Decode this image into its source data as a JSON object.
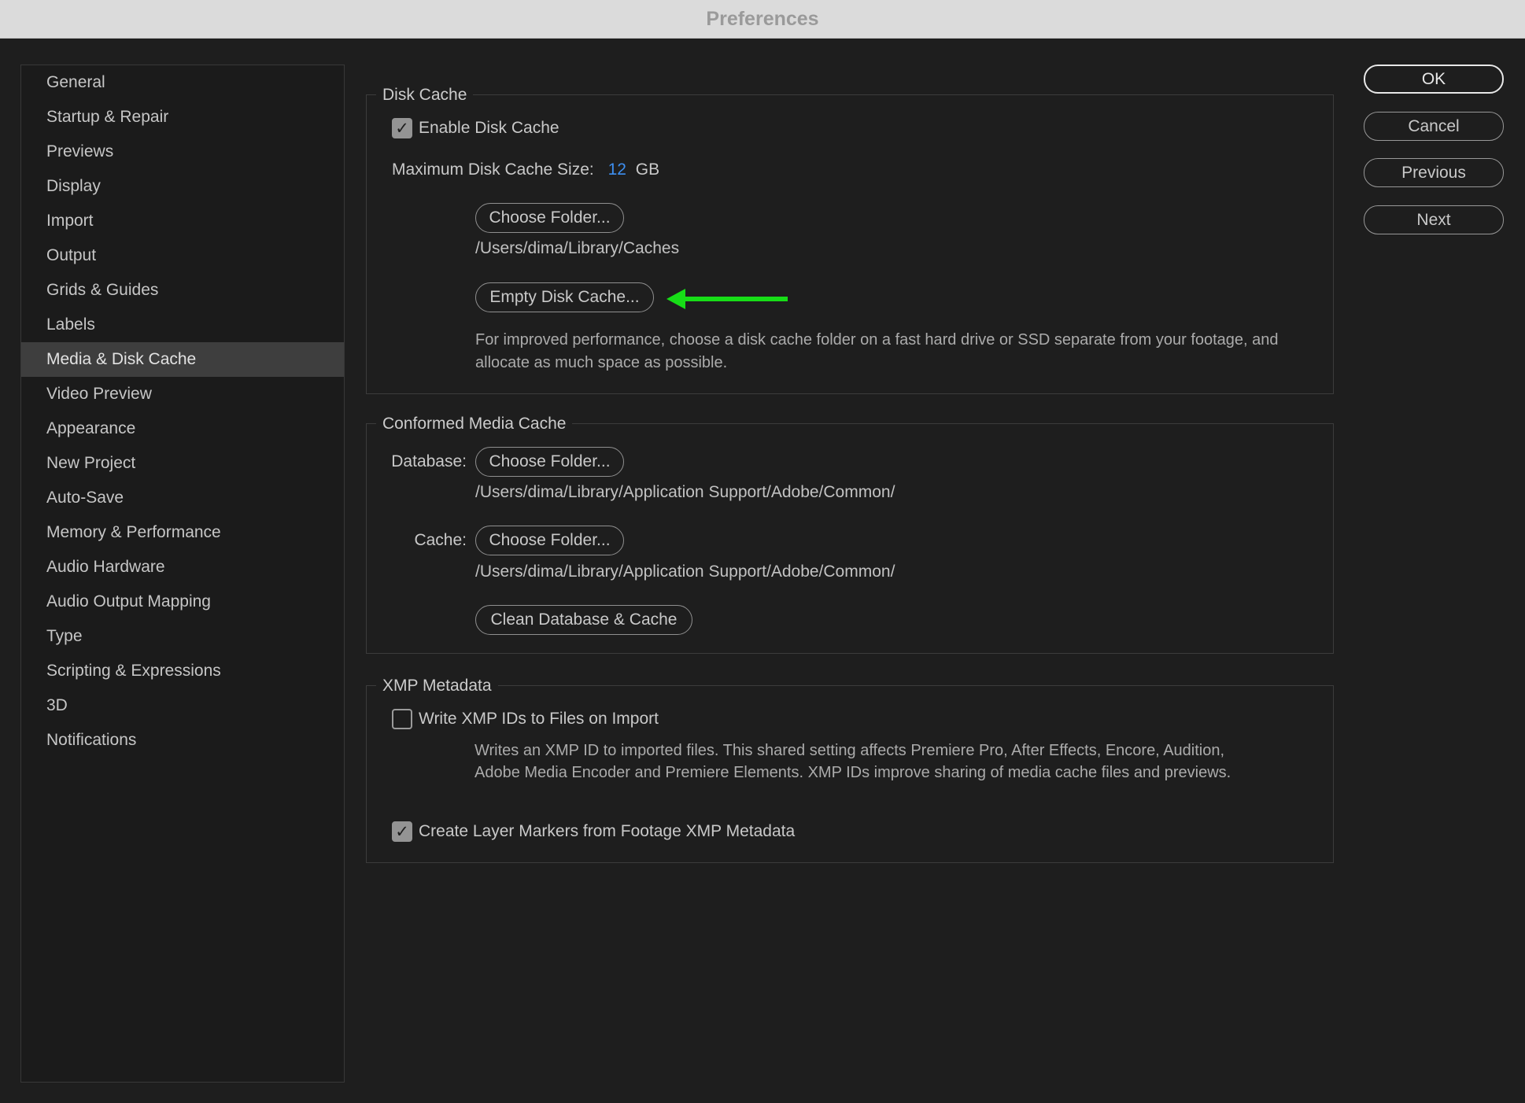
{
  "titlebar": {
    "title": "Preferences"
  },
  "sidebar": {
    "items": [
      {
        "label": "General",
        "selected": false
      },
      {
        "label": "Startup & Repair",
        "selected": false
      },
      {
        "label": "Previews",
        "selected": false
      },
      {
        "label": "Display",
        "selected": false
      },
      {
        "label": "Import",
        "selected": false
      },
      {
        "label": "Output",
        "selected": false
      },
      {
        "label": "Grids & Guides",
        "selected": false
      },
      {
        "label": "Labels",
        "selected": false
      },
      {
        "label": "Media & Disk Cache",
        "selected": true
      },
      {
        "label": "Video Preview",
        "selected": false
      },
      {
        "label": "Appearance",
        "selected": false
      },
      {
        "label": "New Project",
        "selected": false
      },
      {
        "label": "Auto-Save",
        "selected": false
      },
      {
        "label": "Memory & Performance",
        "selected": false
      },
      {
        "label": "Audio Hardware",
        "selected": false
      },
      {
        "label": "Audio Output Mapping",
        "selected": false
      },
      {
        "label": "Type",
        "selected": false
      },
      {
        "label": "Scripting & Expressions",
        "selected": false
      },
      {
        "label": "3D",
        "selected": false
      },
      {
        "label": "Notifications",
        "selected": false
      }
    ]
  },
  "groups": {
    "disk_cache": {
      "legend": "Disk Cache",
      "enable_label": "Enable Disk Cache",
      "enable_checked": true,
      "max_size_label": "Maximum Disk Cache Size:",
      "max_size_value": "12",
      "max_size_unit": "GB",
      "choose_folder_button": "Choose Folder...",
      "folder_path": "/Users/dima/Library/Caches",
      "empty_button": "Empty Disk Cache...",
      "help_text": "For improved performance, choose a disk cache folder on a fast hard drive or SSD separate from your footage, and allocate as much space as possible."
    },
    "conformed": {
      "legend": "Conformed Media Cache",
      "database_label": "Database:",
      "database_button": "Choose Folder...",
      "database_path": "/Users/dima/Library/Application Support/Adobe/Common/",
      "cache_label": "Cache:",
      "cache_button": "Choose Folder...",
      "cache_path": "/Users/dima/Library/Application Support/Adobe/Common/",
      "clean_button": "Clean Database & Cache"
    },
    "xmp": {
      "legend": "XMP Metadata",
      "write_label": "Write XMP IDs to Files on Import",
      "write_checked": false,
      "write_help": "Writes an XMP ID to imported files. This shared setting affects Premiere Pro, After Effects, Encore, Audition, Adobe Media Encoder and Premiere Elements. XMP IDs improve sharing of media cache files and previews.",
      "create_label": "Create Layer Markers from Footage XMP Metadata",
      "create_checked": true
    }
  },
  "actions": {
    "ok": "OK",
    "cancel": "Cancel",
    "previous": "Previous",
    "next": "Next"
  },
  "icons": {
    "check": "✓"
  },
  "colors": {
    "accent_blue": "#3e8ff0",
    "arrow_green": "#17dd17"
  }
}
